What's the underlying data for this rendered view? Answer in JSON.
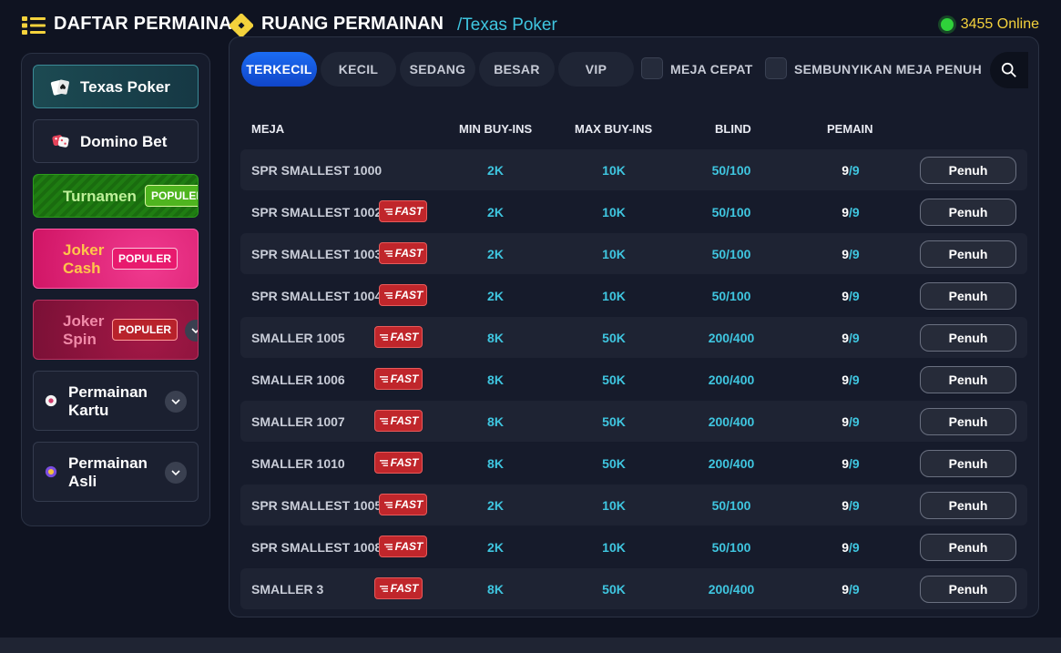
{
  "header": {
    "left_title": "DAFTAR PERMAINAN",
    "room_title": "RUANG PERMAINAN",
    "room_sub": "/Texas Poker",
    "online_text": "3455 Online"
  },
  "sidebar": {
    "texas": "Texas Poker",
    "domino": "Domino Bet",
    "turnamen": "Turnamen",
    "turnamen_badge": "POPULER",
    "joker_cash": "Joker Cash",
    "joker_cash_badge": "POPULER",
    "joker_spin": "Joker Spin",
    "joker_spin_badge": "POPULER",
    "kartu": "Permainan Kartu",
    "asli": "Permainan Asli"
  },
  "tabs": [
    "TERKECIL",
    "KECIL",
    "SEDANG",
    "BESAR",
    "VIP"
  ],
  "filters": {
    "quick": "MEJA CEPAT",
    "hide_full": "SEMBUNYIKAN MEJA PENUH"
  },
  "columns": {
    "table": "MEJA",
    "min": "MIN BUY-INS",
    "max": "MAX BUY-INS",
    "blind": "BLIND",
    "players": "PEMAIN"
  },
  "fast_label": "FAST",
  "rows": [
    {
      "name": "SPR SMALLEST 1000",
      "fast": false,
      "min": "2K",
      "max": "10K",
      "blind": "50/100",
      "cur": "9",
      "max_p": "/9",
      "action": "Penuh"
    },
    {
      "name": "SPR SMALLEST 1002",
      "fast": true,
      "min": "2K",
      "max": "10K",
      "blind": "50/100",
      "cur": "9",
      "max_p": "/9",
      "action": "Penuh"
    },
    {
      "name": "SPR SMALLEST 1003",
      "fast": true,
      "min": "2K",
      "max": "10K",
      "blind": "50/100",
      "cur": "9",
      "max_p": "/9",
      "action": "Penuh"
    },
    {
      "name": "SPR SMALLEST 1004",
      "fast": true,
      "min": "2K",
      "max": "10K",
      "blind": "50/100",
      "cur": "9",
      "max_p": "/9",
      "action": "Penuh"
    },
    {
      "name": "SMALLER 1005",
      "fast": true,
      "min": "8K",
      "max": "50K",
      "blind": "200/400",
      "cur": "9",
      "max_p": "/9",
      "action": "Penuh"
    },
    {
      "name": "SMALLER 1006",
      "fast": true,
      "min": "8K",
      "max": "50K",
      "blind": "200/400",
      "cur": "9",
      "max_p": "/9",
      "action": "Penuh"
    },
    {
      "name": "SMALLER 1007",
      "fast": true,
      "min": "8K",
      "max": "50K",
      "blind": "200/400",
      "cur": "9",
      "max_p": "/9",
      "action": "Penuh"
    },
    {
      "name": "SMALLER 1010",
      "fast": true,
      "min": "8K",
      "max": "50K",
      "blind": "200/400",
      "cur": "9",
      "max_p": "/9",
      "action": "Penuh"
    },
    {
      "name": "SPR SMALLEST 1005",
      "fast": true,
      "min": "2K",
      "max": "10K",
      "blind": "50/100",
      "cur": "9",
      "max_p": "/9",
      "action": "Penuh"
    },
    {
      "name": "SPR SMALLEST 1008",
      "fast": true,
      "min": "2K",
      "max": "10K",
      "blind": "50/100",
      "cur": "9",
      "max_p": "/9",
      "action": "Penuh"
    },
    {
      "name": "SMALLER 3",
      "fast": true,
      "min": "8K",
      "max": "50K",
      "blind": "200/400",
      "cur": "9",
      "max_p": "/9",
      "action": "Penuh"
    }
  ],
  "colors": {
    "accent_cyan": "#3fc6e0",
    "online_yellow": "#f4d23c",
    "online_green": "#2fd13a",
    "tab_active": "#1b6cf2",
    "fast_red": "#c0262b"
  },
  "icons": [
    "list-icon",
    "diamond-icon",
    "spade-cards-icon",
    "dice-icon",
    "card-chip-icon",
    "avatar-coin-icon",
    "chevron-down-icon",
    "search-icon",
    "fast-lines-icon"
  ]
}
